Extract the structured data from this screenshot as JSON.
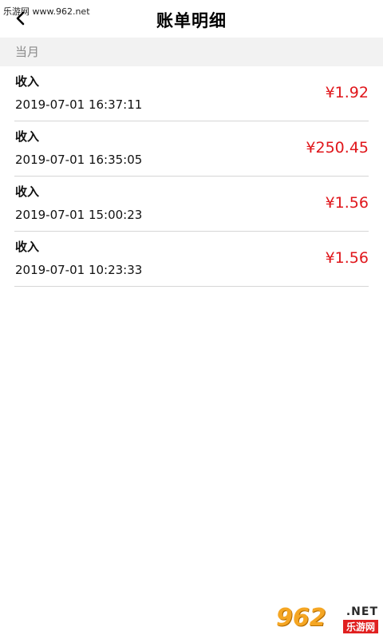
{
  "watermark": {
    "top_text": "乐游网 www.962.net",
    "logo_number": "962",
    "logo_net": ".NET",
    "logo_cn": "乐游网"
  },
  "header": {
    "title": "账单明细",
    "back_icon": "chevron-left-icon"
  },
  "section": {
    "label": "当月"
  },
  "bills": [
    {
      "type": "收入",
      "time": "2019-07-01 16:37:11",
      "amount": "¥1.92"
    },
    {
      "type": "收入",
      "time": "2019-07-01 16:35:05",
      "amount": "¥250.45"
    },
    {
      "type": "收入",
      "time": "2019-07-01 15:00:23",
      "amount": "¥1.56"
    },
    {
      "type": "收入",
      "time": "2019-07-01 10:23:33",
      "amount": "¥1.56"
    }
  ],
  "colors": {
    "amount": "#e0161b",
    "section_bg": "#f2f2f2",
    "divider": "#d6d6d6"
  }
}
